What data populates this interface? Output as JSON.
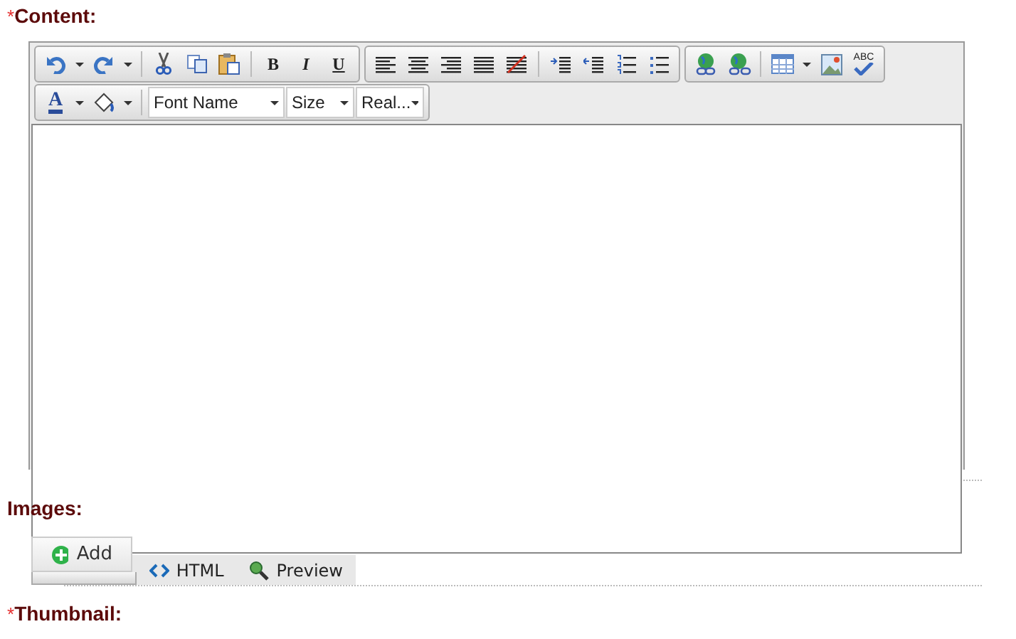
{
  "fields": [
    {
      "marker": "*",
      "label": "Content:"
    },
    {
      "label": "Images:"
    },
    {
      "marker": "*",
      "label": "Thumbnail:"
    }
  ],
  "toolbar": {
    "rows": [
      [
        [
          {
            "kind": "undo"
          },
          {
            "kind": "caret"
          },
          {
            "kind": "redo"
          },
          {
            "kind": "caret"
          },
          {
            "kind": "sep"
          },
          {
            "kind": "cut"
          },
          {
            "kind": "copy"
          },
          {
            "kind": "paste"
          },
          {
            "kind": "sep"
          },
          {
            "kind": "bold",
            "text": "B"
          },
          {
            "kind": "italic",
            "text": "I"
          },
          {
            "kind": "underline",
            "text": "U"
          }
        ],
        [
          {
            "kind": "align-left"
          },
          {
            "kind": "align-center"
          },
          {
            "kind": "align-right"
          },
          {
            "kind": "justify"
          },
          {
            "kind": "clear"
          },
          {
            "kind": "sep"
          },
          {
            "kind": "indent"
          },
          {
            "kind": "outdent"
          },
          {
            "kind": "numbered"
          },
          {
            "kind": "bulleted"
          }
        ],
        [
          {
            "kind": "link"
          },
          {
            "kind": "unlink"
          },
          {
            "kind": "sep"
          },
          {
            "kind": "table"
          },
          {
            "kind": "caret"
          },
          {
            "kind": "image"
          },
          {
            "kind": "spell",
            "text": "ABC"
          }
        ]
      ],
      [
        [
          {
            "kind": "font-color",
            "text": "A"
          },
          {
            "kind": "caret"
          },
          {
            "kind": "fill"
          },
          {
            "kind": "caret"
          },
          {
            "kind": "sep"
          },
          {
            "kind": "wide-select",
            "text": "Font Name"
          },
          {
            "kind": "select",
            "text": "Size"
          },
          {
            "kind": "select",
            "text": "Real..."
          }
        ]
      ]
    ]
  },
  "editor_tabs": [
    {
      "selected": true
    },
    {
      "label": "HTML",
      "selected": false
    },
    {
      "label": "Preview",
      "selected": false
    }
  ],
  "add_button": "Add"
}
